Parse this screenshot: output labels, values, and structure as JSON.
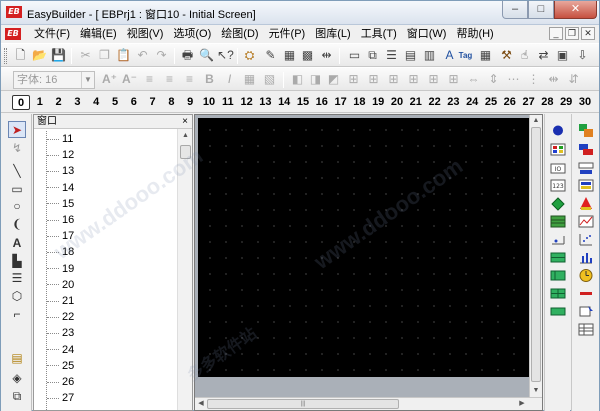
{
  "window": {
    "title": "EasyBuilder - [  EBPrj1  :  窗口10  -  Initial Screen]",
    "logo_text": "EB",
    "minimize_label": "–",
    "maximize_label": "□",
    "close_label": "✕"
  },
  "menubar": {
    "items": [
      "文件(F)",
      "编辑(E)",
      "视图(V)",
      "选项(O)",
      "绘图(D)",
      "元件(P)",
      "图库(L)",
      "工具(T)",
      "窗口(W)",
      "帮助(H)"
    ],
    "mdi_minimize": "_",
    "mdi_restore": "❐",
    "mdi_close": "✕"
  },
  "toolbar2": {
    "font_size_label": "字体: 16",
    "tag_label": "Tag"
  },
  "layers": {
    "active": "0",
    "items": [
      "0",
      "1",
      "2",
      "3",
      "4",
      "5",
      "6",
      "7",
      "8",
      "9",
      "10",
      "11",
      "12",
      "13",
      "14",
      "15",
      "16",
      "17",
      "18",
      "19",
      "20",
      "21",
      "22",
      "23",
      "24",
      "25",
      "26",
      "27",
      "28",
      "29",
      "30"
    ]
  },
  "window_panel": {
    "title": "窗口",
    "close_label": "×",
    "items": [
      "11",
      "12",
      "13",
      "14",
      "15",
      "16",
      "17",
      "18",
      "19",
      "20",
      "21",
      "22",
      "23",
      "24",
      "25",
      "26",
      "27"
    ]
  },
  "watermark": [
    "www.ddooo.com",
    "多多软件站"
  ],
  "colors": {
    "canvas_bg": "#000000",
    "grid_dot": "#7a7a7a",
    "close_button": "#c6503f",
    "logo_red": "#d42020"
  }
}
